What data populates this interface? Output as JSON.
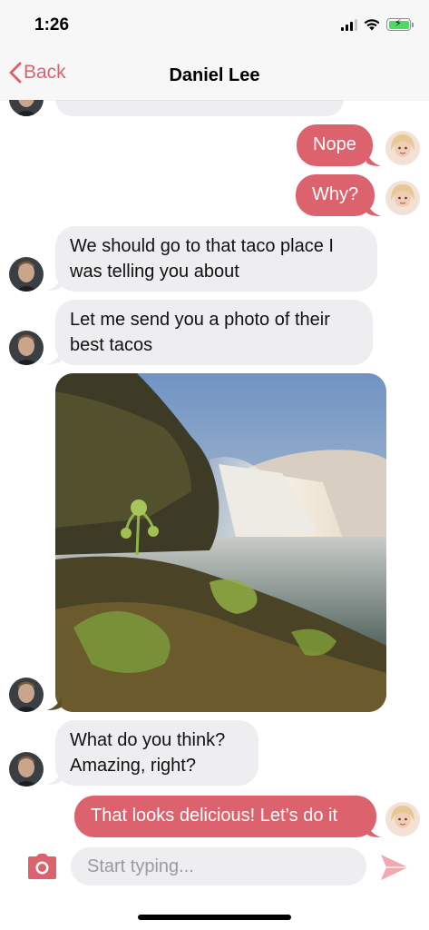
{
  "status_bar": {
    "time": "1:26"
  },
  "nav": {
    "back_label": "Back",
    "title": "Daniel Lee"
  },
  "messages": [
    {
      "id": "m0",
      "direction": "incoming",
      "text": ""
    },
    {
      "id": "m1",
      "direction": "outgoing",
      "text": "Nope"
    },
    {
      "id": "m2",
      "direction": "outgoing",
      "text": "Why?"
    },
    {
      "id": "m3",
      "direction": "incoming",
      "line1": "We should go to that taco place I",
      "line2": "was telling you about"
    },
    {
      "id": "m4",
      "direction": "incoming",
      "line1": "Let me send you a photo of their",
      "line2": "best tacos"
    },
    {
      "id": "m5",
      "direction": "incoming",
      "type": "photo",
      "subject": "waterfall landscape"
    },
    {
      "id": "m6",
      "direction": "incoming",
      "line1": "What do you think?",
      "line2": "Amazing, right?"
    },
    {
      "id": "m7",
      "direction": "outgoing",
      "text": "That looks delicious! Let’s do it"
    }
  ],
  "composer": {
    "placeholder": "Start typing...",
    "camera_icon": "camera-icon",
    "send_icon": "send-icon"
  },
  "colors": {
    "accent": "#dc636d",
    "incoming_bubble": "#eeeef0",
    "outgoing_text": "#ffffff"
  }
}
